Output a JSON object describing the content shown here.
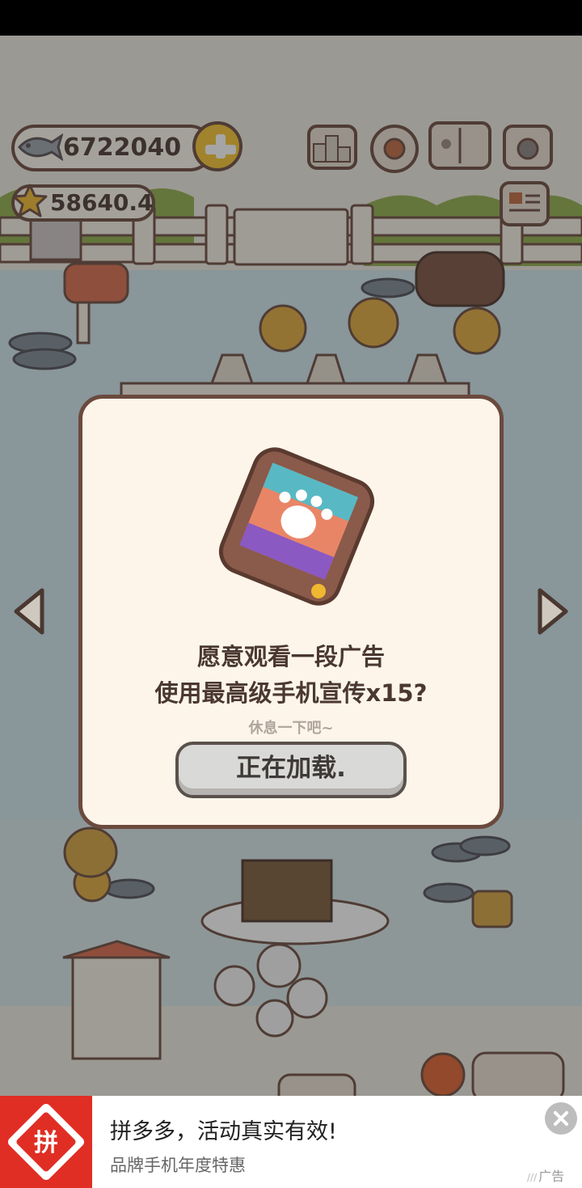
{
  "hud": {
    "fish_count": "6722040",
    "star_count": "58640.4",
    "icons": [
      "fish-icon",
      "star-icon",
      "plus-icon",
      "ranking-icon",
      "settings-icon",
      "album-icon",
      "camera-icon",
      "newspaper-icon"
    ]
  },
  "dialog": {
    "line1": "愿意观看一段广告",
    "line2": "使用最高级手机宣传x15?",
    "subtitle": "休息一下吧~",
    "button_label": "正在加载."
  },
  "ad": {
    "logo_text": "拼",
    "title": "拼多多，活动真实有效!",
    "subtitle": "品牌手机年度特惠",
    "tag": "广告"
  },
  "colors": {
    "dialog_bg": "#fdf5ea",
    "dialog_border": "#6b4a3e",
    "button_bg": "#d9d9d7",
    "ad_brand": "#e02e24"
  }
}
